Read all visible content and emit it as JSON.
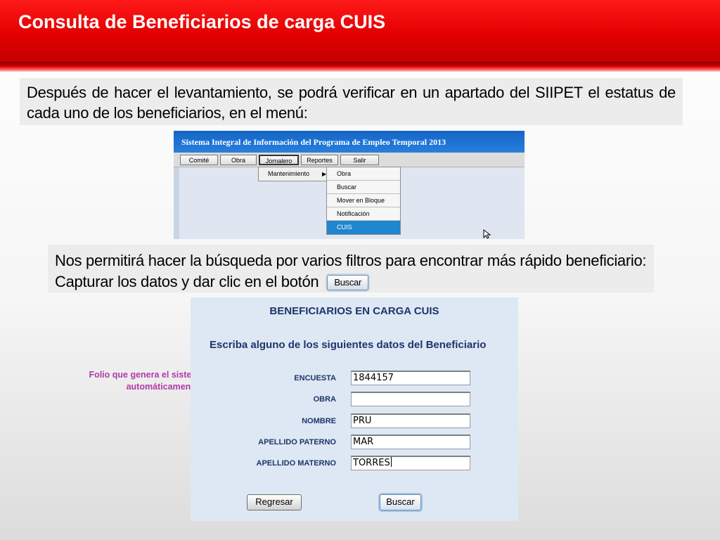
{
  "slide": {
    "title": "Consulta de Beneficiarios de carga CUIS",
    "intro_text": "Después de hacer el levantamiento, se podrá verificar en un apartado del SIIPET el estatus de cada uno de los beneficiarios, en el menú:",
    "filters_line1": "Nos permitirá hacer la búsqueda por varios filtros para encontrar más rápido beneficiario:",
    "filters_line2": "Capturar los datos y dar clic en el botón",
    "inline_button_label": "Buscar",
    "annotation": "Folio que genera el sistema SIIPSO automáticamente"
  },
  "menu_app": {
    "title": "Sistema Integral de Información del Programa de Empleo Temporal 2013",
    "menu": [
      "Comité",
      "Obra",
      "Jornalero",
      "Reportes",
      "Salir"
    ],
    "submenu": "Mantenimiento",
    "dropdown": [
      "Obra",
      "Buscar",
      "Mover en Bloque",
      "Notificación",
      "CUIS"
    ],
    "selected": "CUIS"
  },
  "form": {
    "title": "BENEFICIARIOS EN CARGA CUIS",
    "subtitle": "Escriba alguno de los siguientes datos del Beneficiario",
    "fields": [
      {
        "label": "ENCUESTA",
        "value": "1844157"
      },
      {
        "label": "OBRA",
        "value": ""
      },
      {
        "label": "NOMBRE",
        "value": "PRU"
      },
      {
        "label": "APELLIDO PATERNO",
        "value": "MAR"
      },
      {
        "label": "APELLIDO MATERNO",
        "value": "TORRES"
      }
    ],
    "reset_label": "Regresar",
    "search_label": "Buscar"
  },
  "colors": {
    "header_red": "#e40000",
    "app_titlebar_blue": "#1e74d6",
    "selected_item_blue": "#1f86cf",
    "form_text_navy": "#1e3568",
    "annotation_purple": "#b03aa8"
  }
}
